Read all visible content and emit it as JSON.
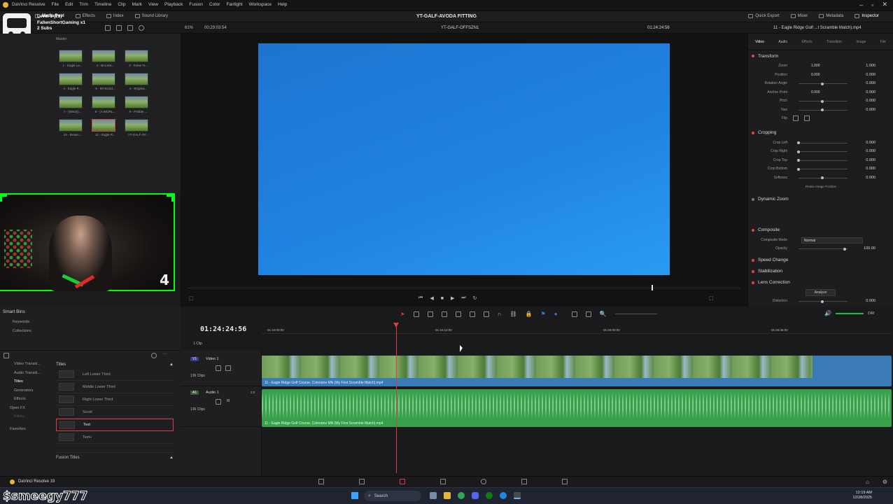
{
  "menubar": {
    "app": "DaVinci Resolve",
    "items": [
      "File",
      "Edit",
      "Trim",
      "Timeline",
      "Clip",
      "Mark",
      "View",
      "Playback",
      "Fusion",
      "Color",
      "Fairlight",
      "Workspace",
      "Help"
    ]
  },
  "toolbar": {
    "left_items": [
      "Media Pool",
      "Effects",
      "Index",
      "Sound Library"
    ],
    "project_title": "YT-GALF-AVODA FITTING",
    "right_items": [
      "Quick Export",
      "Mixer",
      "Metadata",
      "Inspector"
    ]
  },
  "overlay": {
    "line1": "Level 1 (21)",
    "line2": "FallenShortGaming x1",
    "line3": "2 Subs",
    "webcam_counter": "4",
    "handle": "$smeegy777"
  },
  "subbar": {
    "zoom": "61%",
    "source_timecode": "00:29:03:54",
    "timeline_name": "YT-GALF-OFFSZN1",
    "record_timecode": "01:24:24:56",
    "inspector_clip": "11 - Eagle Ridge Golf ...t Scramble Match).mp4"
  },
  "mediapool": {
    "bin_label": "Master",
    "clips": [
      {
        "label": "1 - Eagle La..."
      },
      {
        "label": "2 - Brookst..."
      },
      {
        "label": "3 - Roker N..."
      },
      {
        "label": "4 - Eagle R..."
      },
      {
        "label": "5 - 90 World..."
      },
      {
        "label": "6 - Brightw..."
      },
      {
        "label": "7 - (Windy)..."
      },
      {
        "label": "8 - (A WORL..."
      },
      {
        "label": "9 - Pebble ..."
      },
      {
        "label": "10 - Brown..."
      },
      {
        "label": "11 - Eagle R..."
      },
      {
        "label": "YT-GALF-OF..."
      }
    ]
  },
  "leftpanel": {
    "smart_bins": "Smart Bins",
    "bins": [
      "Keywords",
      "Collections"
    ],
    "toolbox": {
      "tree": [
        "Video Transiti...",
        "Audio Transiti...",
        "Titles",
        "Generators",
        "Effects",
        "Open FX",
        "Filters"
      ],
      "favorites": "Favorites",
      "section": "Titles",
      "titles": [
        "Left Lower Third",
        "Middle Lower Third",
        "Right Lower Third",
        "Scroll",
        "Text",
        "Text+"
      ],
      "fusion_titles": "Fusion Titles"
    }
  },
  "inspector": {
    "tabs": [
      "Video",
      "Audio",
      "Effects",
      "Transition",
      "Image",
      "File"
    ],
    "transform": {
      "title": "Transform",
      "rows": [
        {
          "label": "Zoom",
          "x": "1.000",
          "y": "1.000"
        },
        {
          "label": "Position",
          "x": "0.000",
          "y": "0.000"
        },
        {
          "label": "Rotation Angle",
          "value": "0.000"
        },
        {
          "label": "Anchor Point",
          "x": "0.000",
          "y": "0.000"
        },
        {
          "label": "Pitch",
          "value": "0.000"
        },
        {
          "label": "Yaw",
          "value": "0.000"
        },
        {
          "label": "Flip"
        }
      ]
    },
    "cropping": {
      "title": "Cropping",
      "rows": [
        {
          "label": "Crop Left",
          "value": "0.000"
        },
        {
          "label": "Crop Right",
          "value": "0.000"
        },
        {
          "label": "Crop Top",
          "value": "0.000"
        },
        {
          "label": "Crop Bottom",
          "value": "0.000"
        },
        {
          "label": "Softness",
          "value": "0.000"
        }
      ],
      "retain": "Retain Image Position"
    },
    "dynamic_zoom": "Dynamic Zoom",
    "composite": {
      "title": "Composite",
      "mode_label": "Composite Mode",
      "mode_value": "Normal",
      "opacity_label": "Opacity",
      "opacity_value": "100.00"
    },
    "speed_change": "Speed Change",
    "stabilization": "Stabilization",
    "lens_correction": {
      "title": "Lens Correction",
      "analyze": "Analyze",
      "distortion_label": "Distortion",
      "distortion_value": "0.000"
    }
  },
  "timeline": {
    "timecode": "01:24:24:56",
    "ruler": [
      "01:24:00:00",
      "01:24:12:00",
      "01:25:00:00",
      "01:25:36:00"
    ],
    "video_track": {
      "id": "V1",
      "name": "Video 1",
      "count": "136 Clips"
    },
    "audio_track": {
      "id": "A1",
      "name": "Audio 1",
      "level": "2.0",
      "count": "136 Clips"
    },
    "top_count": "1 Clip",
    "clip_label": "11 - Eagle Ridge Golf Course, Coleraine MN (My First Scramble Match).mp4",
    "db_label": "DIM"
  },
  "pagebar": {
    "app_label": "DaVinci Resolve 19"
  },
  "taskbar": {
    "search": "Search",
    "time": "12:19 AM",
    "date": "12/28/2025"
  }
}
